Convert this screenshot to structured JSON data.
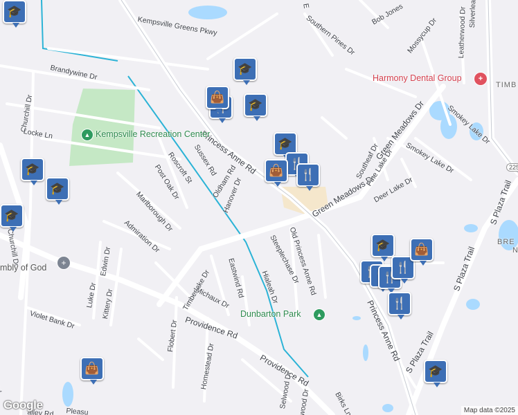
{
  "map": {
    "streets": {
      "kempsville_greens_pkwy": "Kempsville Greens Pkwy",
      "brandywine_dr": "Brandywine Dr",
      "churchill_dr": "Churchill Dr",
      "churchill_dr_2": "Churchill Dr",
      "locke_ln": "Locke Ln",
      "princess_anne_rd": "Princess Anne Rd",
      "princess_anne_rd_2": "Princess Anne Rd",
      "sussex_rd": "Sussex Rd",
      "oldham_rd": "Oldham Rd",
      "hanover_dr": "Hanover Dr",
      "roscroft_st": "Roscroft St",
      "post_oak_dr": "Post Oak Dr",
      "marlborough_dr": "Marlborough Dr",
      "admiration_dr": "Admiration Dr",
      "edwin_dr": "Edwin Dr",
      "luke_dr": "Luke Dr",
      "kittery_dr": "Kittery Dr",
      "violet_bank_dr": "Violet Bank Dr",
      "timberlake_dr": "Timberlake Dr",
      "michaux_dr": "Michaux Dr",
      "eastwind_rd": "Eastwind Rd",
      "flobert_dr": "Flobert Dr",
      "providence_rd": "Providence Rd",
      "providence_rd_2": "Providence Rd",
      "homestead_dr": "Homestead Dr",
      "selwood_dr": "Selwood Dr",
      "hialeah_dr": "Hialeah Dr",
      "steeplechase_dr": "Steeplechase Dr",
      "old_princess_anne_rd": "Old Princess Anne Rd",
      "green_meadows_dr": "Green Meadows Dr",
      "green_meadows_dr_2": "Green Meadows Dr",
      "southeaf_dr": "Southeaf Dr",
      "pine_lake_dr": "Pine Lake Dr",
      "deer_lake_dr": "Deer Lake Dr",
      "smokey_lake_dr": "Smokey Lake Dr",
      "smokey_lake_dr_2": "Smokey Lake Dr",
      "southern_pines_dr": "Southern Pines Dr",
      "bob_jones": "Bob Jones",
      "mossycup_dr": "Mossycup Dr",
      "leatherwood_dr": "Leatherwood Dr",
      "silverleaf": "Silverleaf",
      "s_plaza_trail": "S Plaza Trail",
      "s_plaza_trail_2": "S Plaza Trail",
      "s_plaza_trail_3": "S Plaza Trail",
      "birks_ln": "Birks Ln",
      "e_partial": "E",
      "pleasure_partial": "Pleasu",
      "valley_partial": "alley Rd",
      "road_partial": "wood Dr",
      "left_partial": "ad"
    },
    "places": {
      "kempsville_rec": "Kempsville Recreation Center",
      "dunbarton_park": "Dunbarton Park",
      "harmony_dental": "Harmony Dental Group",
      "assembly_of_god": "mbly of God",
      "timb": "TIMB",
      "bre": "BRE",
      "n_partial": "N"
    },
    "highway_shield": "225",
    "icons": {
      "school": "graduation-cap-icon",
      "restaurant": "fork-knife-icon",
      "shopping": "shopping-bag-icon",
      "park": "tree-icon",
      "church": "cross-icon",
      "dental": "tooth-icon"
    },
    "colors": {
      "pin": "#3d6fb5",
      "park_green": "#c5e8c5",
      "water": "#aadaff",
      "route": "#2bb3d6",
      "commercial": "#f5e7cc"
    },
    "attribution": "Map data ©2025",
    "logo": "Google"
  }
}
